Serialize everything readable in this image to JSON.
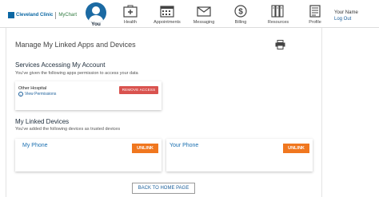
{
  "header": {
    "logo_brand": "Cleveland Clinic",
    "logo_product": "MyChart",
    "you_label": "You",
    "nav": [
      {
        "label": "Health",
        "icon": "health-icon"
      },
      {
        "label": "Appointments",
        "icon": "calendar-icon"
      },
      {
        "label": "Messaging",
        "icon": "envelope-icon"
      },
      {
        "label": "Billing",
        "icon": "dollar-icon"
      },
      {
        "label": "Resources",
        "icon": "books-icon"
      },
      {
        "label": "Profile",
        "icon": "profile-icon"
      }
    ],
    "user_name": "Your Name",
    "logout_label": "Log Out"
  },
  "page": {
    "title": "Manage My Linked Apps and Devices"
  },
  "services": {
    "title": "Services Accessing My Account",
    "subtitle": "You've given the following apps permission to access your data",
    "items": [
      {
        "name": "Other Hospital",
        "link_label": "View Permissions",
        "button_label": "REMOVE ACCESS"
      }
    ]
  },
  "devices": {
    "title": "My Linked Devices",
    "subtitle": "You've added the following devices as trusted devices",
    "items": [
      {
        "name": "My Phone",
        "button_label": "UNLINK"
      },
      {
        "name": "Your Phone",
        "button_label": "UNLINK"
      }
    ]
  },
  "footer": {
    "home_button_label": "BACK TO HOME PAGE"
  },
  "colors": {
    "brand_blue": "#1b6aa3",
    "link_blue": "#1a5e9a",
    "remove_red": "#d9534f",
    "unlink_orange": "#f0771f"
  }
}
